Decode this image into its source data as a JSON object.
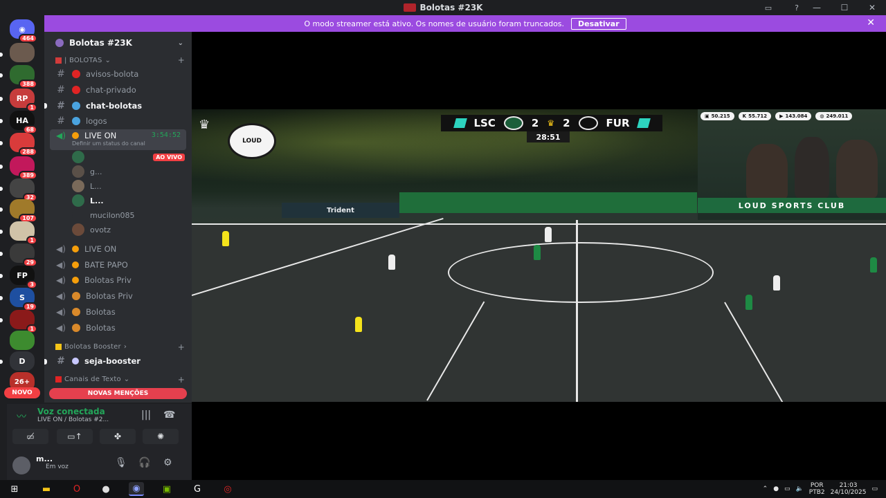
{
  "window": {
    "title": "Bolotas #23K",
    "controls": [
      "minimize",
      "maximize",
      "close"
    ]
  },
  "banner": {
    "message": "O modo streamer está ativo. Os nomes de usuário foram truncados.",
    "button": "Desativar"
  },
  "guild_badges": [
    "464",
    "388",
    "1",
    "68",
    "288",
    "389",
    "32",
    "107",
    "1",
    "29",
    "3",
    "19",
    "1",
    "26+"
  ],
  "guild_d": "D",
  "novo_label": "NOVO",
  "server": {
    "name": "Bolotas #23K",
    "category1": "| BOLOTAS",
    "text_channels": [
      {
        "name": "avisos-bolota"
      },
      {
        "name": "chat-privado"
      },
      {
        "name": "chat-bolotas"
      },
      {
        "name": "logos"
      }
    ],
    "active_voice": {
      "name": "LIVE ON",
      "timer": "3:54:52",
      "status_hint": "Definir um status do canal"
    },
    "members": [
      {
        "name": "",
        "live": "AO VIVO"
      },
      {
        "name": "g..."
      },
      {
        "name": "L..."
      },
      {
        "name": "L..."
      },
      {
        "name": "mucilon085"
      },
      {
        "name": "ovotz"
      }
    ],
    "voice_channels": [
      "LIVE ON",
      "BATE PAPO",
      "Bolotas Priv",
      "Bolotas Priv",
      "Bolotas",
      "Bolotas"
    ],
    "category2": "Bolotas Booster",
    "booster_channel": "seja-booster",
    "category3": "Canais de Texto"
  },
  "mentions_label": "NOVAS MENÇÕES",
  "voice": {
    "status": "Voz conectada",
    "channel": "LIVE ON / Bolotas #2..."
  },
  "user": {
    "name": "m...",
    "status": "Em voz"
  },
  "stream": {
    "home_team": "LSC",
    "away_team": "FUR",
    "home_score": "2",
    "away_score": "2",
    "clock": "28:51",
    "sponsor": "Trident",
    "stats": [
      "50.215",
      "55.712",
      "143.084",
      "249.011"
    ],
    "loud_bar": "LOUD SPORTS CLUB"
  },
  "taskbar": {
    "lang_top": "POR",
    "lang_bottom": "PTB2",
    "time": "21:03",
    "date": "24/10/2025"
  }
}
